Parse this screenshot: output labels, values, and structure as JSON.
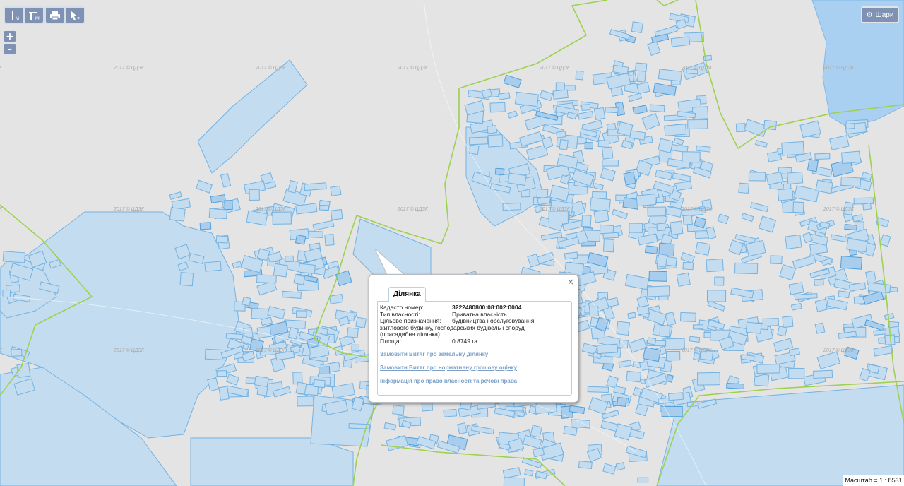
{
  "toolbar": {
    "measure_distance_icon": "ruler-line-icon",
    "measure_area_icon": "ruler-area-icon",
    "print_icon": "printer-icon",
    "identify_icon": "cursor-question-icon"
  },
  "zoom": {
    "in_label": "+",
    "out_label": "-"
  },
  "layers": {
    "label": "Шари",
    "icon": "gear-icon"
  },
  "watermark": "2017 © ЦДЗК",
  "popup": {
    "tab_label": "Ділянка",
    "close_label": "×",
    "fields": {
      "cadastral_label": "Кадастр.номер:",
      "cadastral_value": "3222480800:08:002:0004",
      "ownership_label": "Тип власності:",
      "ownership_value": "Приватна власність",
      "purpose_label": "Цільове призначення:",
      "purpose_value_1": "будівництва і обслуговування",
      "purpose_value_2": "житлового будинку, господарських будівель і споруд",
      "purpose_value_3": "(присадибна ділянка)",
      "area_label": "Площа:",
      "area_value": "0.8749 га"
    },
    "links": {
      "extract_parcel": "Замовити Витяг про земельну ділянку",
      "extract_valuation": "Замовити Витяг про нормативну грошову оцінку",
      "rights_info": "Інформація про право власності та речові права"
    }
  },
  "scale": {
    "label": "Масштаб = 1 : 8531"
  },
  "colors": {
    "parcel_fill": "#c3dcef",
    "parcel_stroke": "#75b2e1",
    "boundary": "#9ed14f",
    "background": "#e4e4e4"
  }
}
